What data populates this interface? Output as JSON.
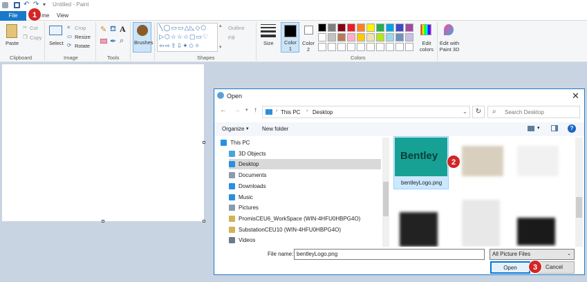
{
  "window": {
    "title": "Untitled - Paint"
  },
  "tabs": {
    "file": "File",
    "home": "Home",
    "view": "View"
  },
  "ribbon": {
    "clipboard": {
      "paste": "Paste",
      "cut": "Cut",
      "copy": "Copy",
      "label": "Clipboard"
    },
    "image": {
      "select": "Select",
      "crop": "Crop",
      "resize": "Resize",
      "rotate": "Rotate",
      "label": "Image"
    },
    "tools": {
      "label": "Tools"
    },
    "brushes": "Brushes",
    "shapes": {
      "outline": "Outline",
      "fill": "Fill",
      "label": "Shapes"
    },
    "size": "Size",
    "color1": "Color 1",
    "color2": "Color 2",
    "colors": {
      "edit": "Edit colors",
      "label": "Colors",
      "palette": [
        "#000000",
        "#7f7f7f",
        "#880015",
        "#ed1c24",
        "#ff7f27",
        "#fff200",
        "#22b14c",
        "#00a2e8",
        "#3f48cc",
        "#a349a4",
        "#ffffff",
        "#c3c3c3",
        "#b97a57",
        "#ffaec9",
        "#ffc90e",
        "#efe4b0",
        "#b5e61d",
        "#99d9ea",
        "#7092be",
        "#c8bfe7"
      ]
    },
    "paint3d": "Edit with Paint 3D"
  },
  "dialog": {
    "title": "Open",
    "breadcrumb": [
      "This PC",
      "Desktop"
    ],
    "search_placeholder": "Search Desktop",
    "organize": "Organize",
    "new_folder": "New folder",
    "tree": [
      "This PC",
      "3D Objects",
      "Desktop",
      "Documents",
      "Downloads",
      "Music",
      "Pictures",
      "PromisCEU6_WorkSpace (WIN-4HFU0HBPG4O)",
      "SubstationCEU10 (WIN-4HFU0HBPG4O)",
      "Videos"
    ],
    "selected_file": {
      "name": "bentleyLogo.png",
      "logo_text": "Bentley"
    },
    "file_name_label": "File name:",
    "file_name_value": "bentleyLogo.png",
    "file_type": "All Picture Files",
    "open": "Open",
    "cancel": "Cancel"
  },
  "steps": [
    "1",
    "2",
    "3"
  ]
}
